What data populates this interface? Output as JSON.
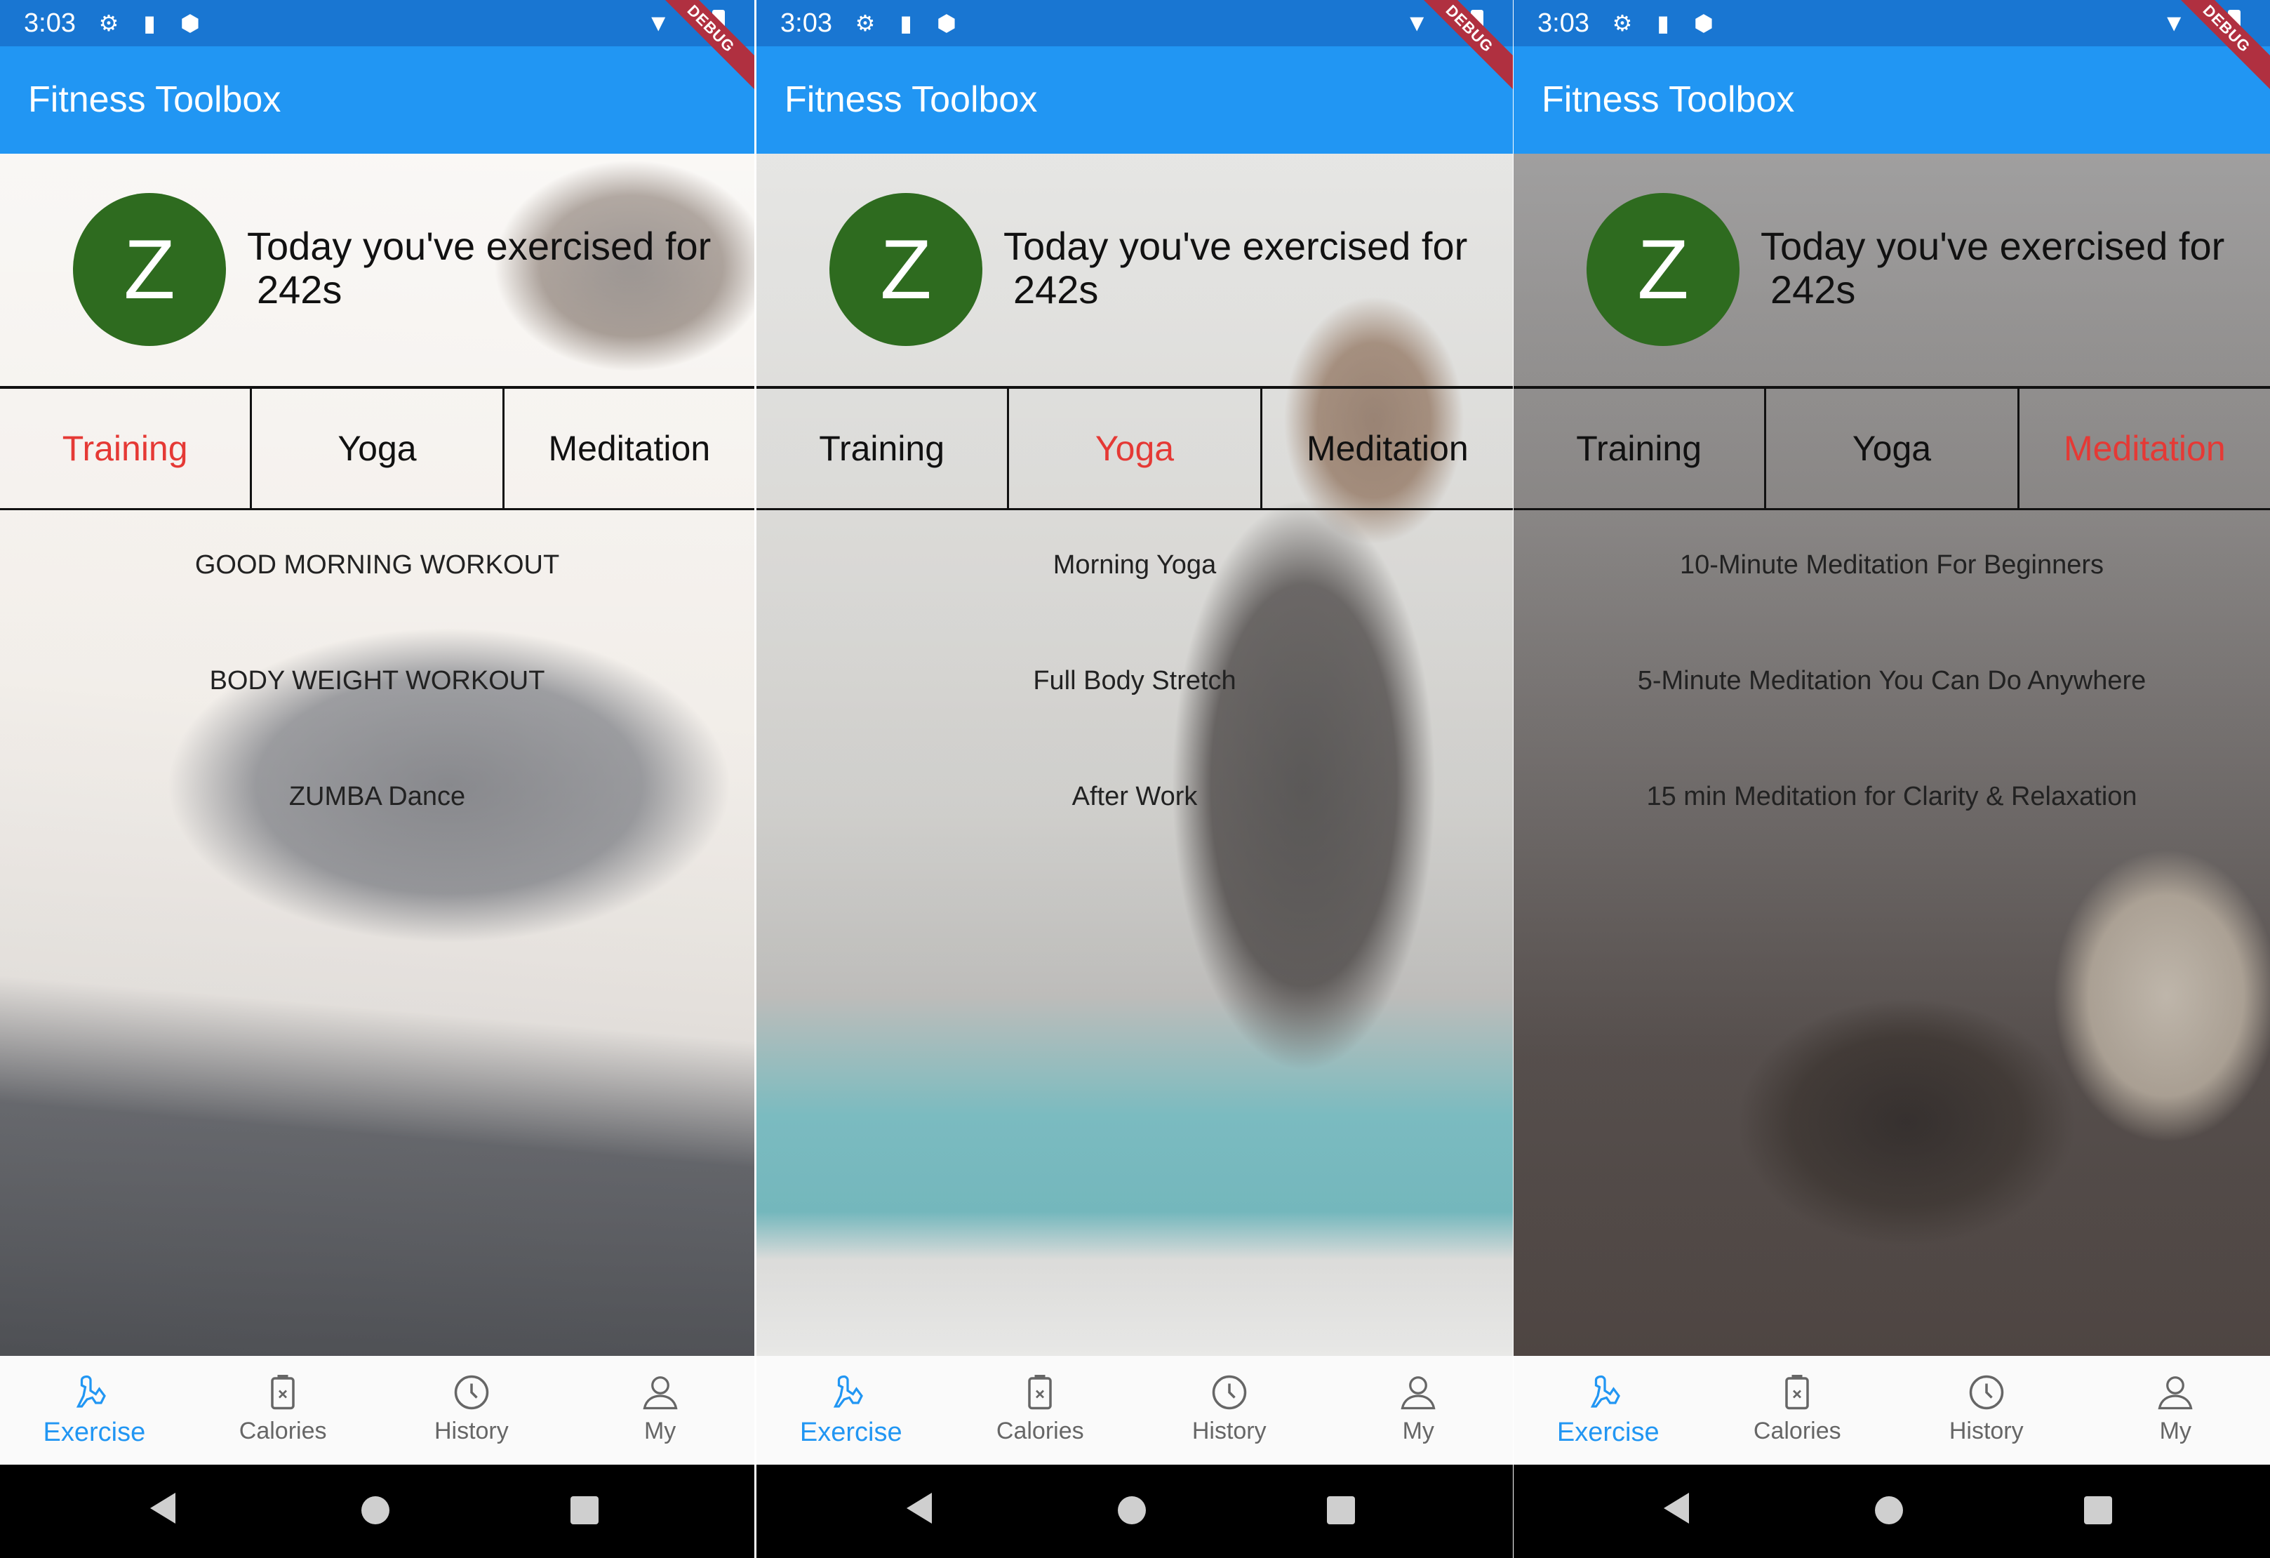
{
  "colors": {
    "status_bar": "#1976d2",
    "app_bar": "#2196f3",
    "avatar_bg": "#2e6b1f",
    "active_tab": "#e53935",
    "active_nav": "#2196f3"
  },
  "status": {
    "time": "3:03",
    "debug_label": "DEBUG"
  },
  "app": {
    "title": "Fitness Toolbox"
  },
  "header": {
    "avatar_letter": "Z",
    "line1": "Today you've exercised for",
    "line2": "242s"
  },
  "tabs": [
    "Training",
    "Yoga",
    "Meditation"
  ],
  "screens": [
    {
      "active_tab": "Training",
      "items": [
        "GOOD MORNING WORKOUT",
        "BODY WEIGHT WORKOUT",
        "ZUMBA Dance"
      ]
    },
    {
      "active_tab": "Yoga",
      "items": [
        "Morning Yoga",
        "Full Body Stretch",
        "After Work"
      ]
    },
    {
      "active_tab": "Meditation",
      "items": [
        "10-Minute Meditation For Beginners",
        "5-Minute Meditation You Can Do Anywhere",
        "15 min Meditation for Clarity & Relaxation"
      ]
    }
  ],
  "bottom_nav": [
    {
      "label": "Exercise",
      "icon": "exercise-icon",
      "active": true
    },
    {
      "label": "Calories",
      "icon": "calories-icon",
      "active": false
    },
    {
      "label": "History",
      "icon": "history-icon",
      "active": false
    },
    {
      "label": "My",
      "icon": "person-icon",
      "active": false
    }
  ]
}
